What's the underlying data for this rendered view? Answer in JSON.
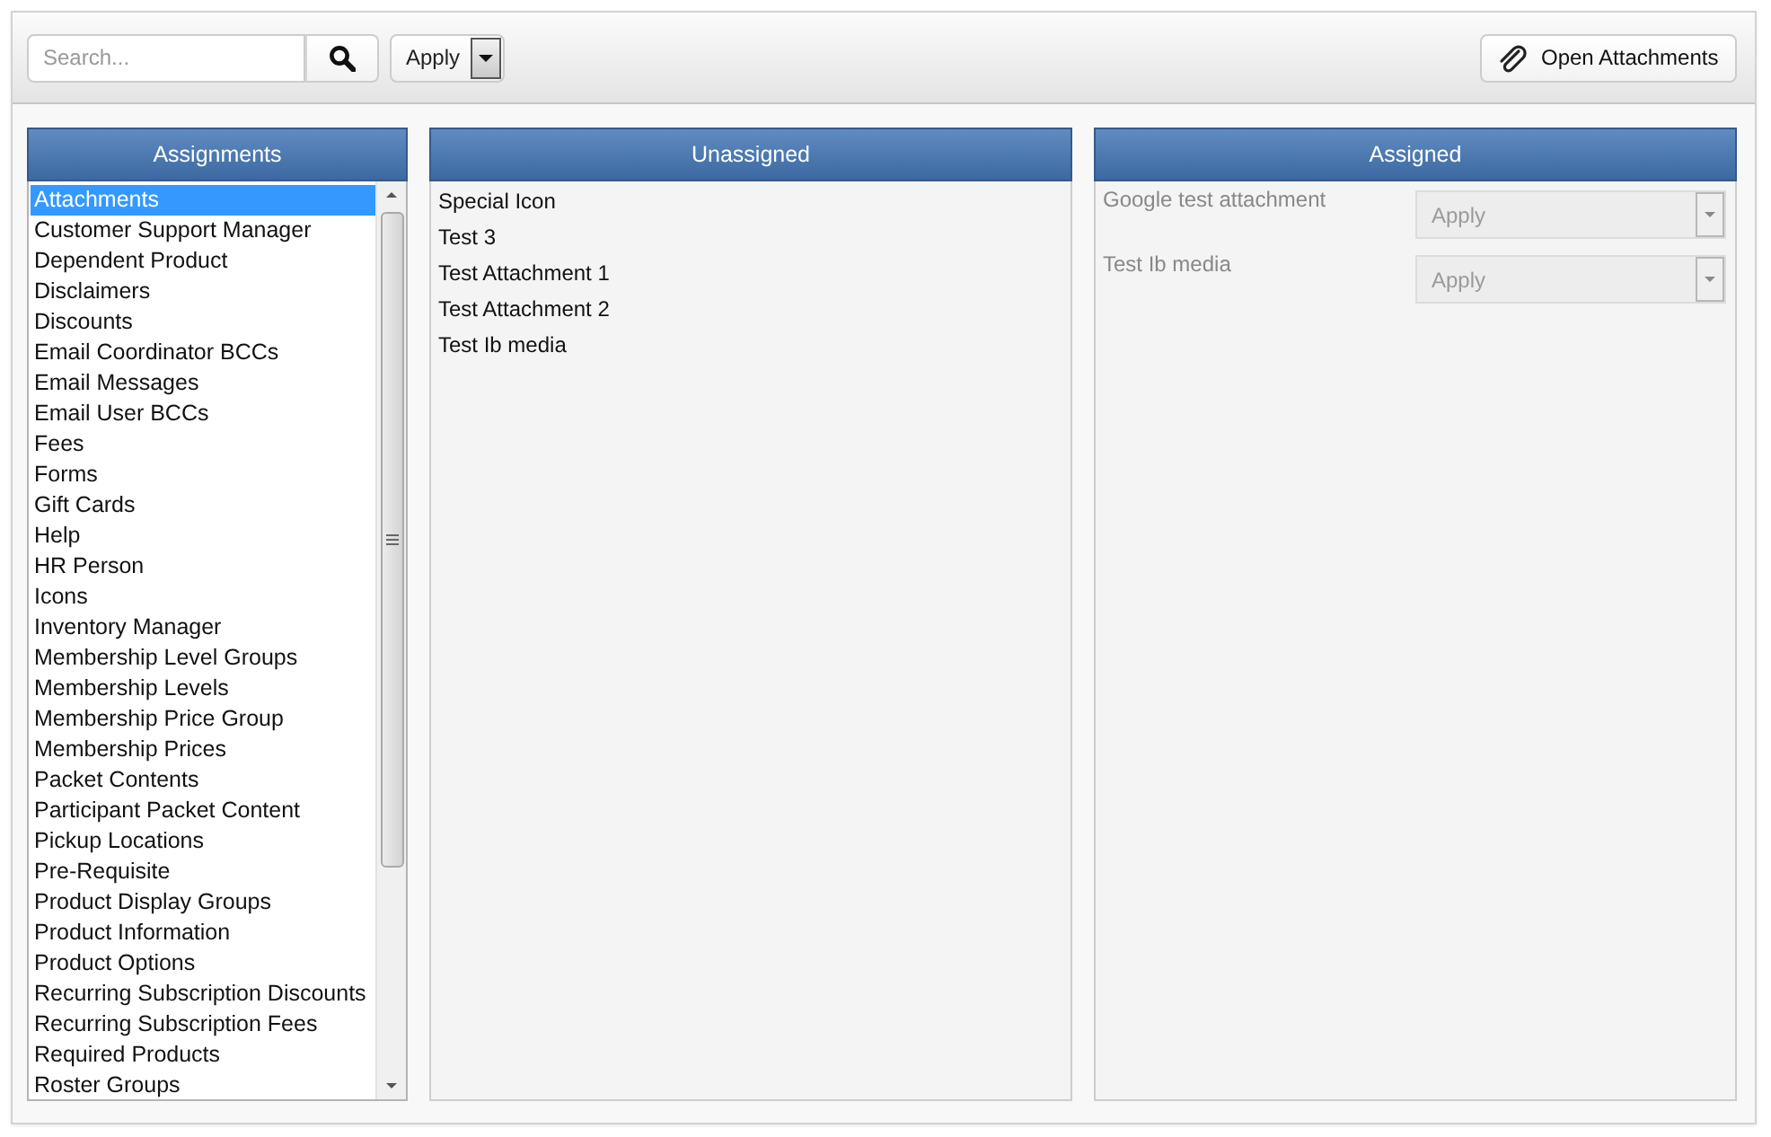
{
  "toolbar": {
    "search": {
      "placeholder": "Search..."
    },
    "apply_dropdown": {
      "value": "Apply"
    },
    "open_attachments_button": {
      "label": "Open Attachments"
    }
  },
  "assignments": {
    "title": "Assignments",
    "items": [
      {
        "label": "Attachments",
        "selected": true
      },
      {
        "label": "Customer Support Manager",
        "selected": false
      },
      {
        "label": "Dependent Product",
        "selected": false
      },
      {
        "label": "Disclaimers",
        "selected": false
      },
      {
        "label": "Discounts",
        "selected": false
      },
      {
        "label": "Email Coordinator BCCs",
        "selected": false
      },
      {
        "label": "Email Messages",
        "selected": false
      },
      {
        "label": "Email User BCCs",
        "selected": false
      },
      {
        "label": "Fees",
        "selected": false
      },
      {
        "label": "Forms",
        "selected": false
      },
      {
        "label": "Gift Cards",
        "selected": false
      },
      {
        "label": "Help",
        "selected": false
      },
      {
        "label": "HR Person",
        "selected": false
      },
      {
        "label": "Icons",
        "selected": false
      },
      {
        "label": "Inventory Manager",
        "selected": false
      },
      {
        "label": "Membership Level Groups",
        "selected": false
      },
      {
        "label": "Membership Levels",
        "selected": false
      },
      {
        "label": "Membership Price Group",
        "selected": false
      },
      {
        "label": "Membership Prices",
        "selected": false
      },
      {
        "label": "Packet Contents",
        "selected": false
      },
      {
        "label": "Participant Packet Content",
        "selected": false
      },
      {
        "label": "Pickup Locations",
        "selected": false
      },
      {
        "label": "Pre-Requisite",
        "selected": false
      },
      {
        "label": "Product Display Groups",
        "selected": false
      },
      {
        "label": "Product Information",
        "selected": false
      },
      {
        "label": "Product Options",
        "selected": false
      },
      {
        "label": "Recurring Subscription Discounts",
        "selected": false
      },
      {
        "label": "Recurring Subscription Fees",
        "selected": false
      },
      {
        "label": "Required Products",
        "selected": false
      },
      {
        "label": "Roster Groups",
        "selected": false
      }
    ]
  },
  "unassigned": {
    "title": "Unassigned",
    "items": [
      "Special Icon",
      "Test 3",
      "Test Attachment 1",
      "Test Attachment 2",
      "Test Ib media"
    ]
  },
  "assigned": {
    "title": "Assigned",
    "rows": [
      {
        "name": "Google test attachment",
        "value": "Apply",
        "disabled": true
      },
      {
        "name": "Test Ib media",
        "value": "Apply",
        "disabled": true
      }
    ]
  }
}
